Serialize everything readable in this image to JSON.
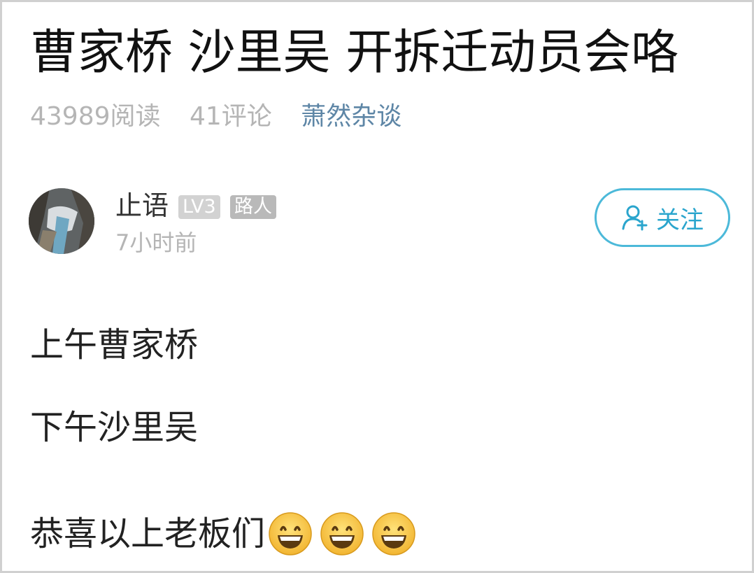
{
  "post": {
    "title": "曹家桥 沙里吴 开拆迁动员会咯",
    "reads": "43989阅读",
    "comments": "41评论",
    "topic": "萧然杂谈"
  },
  "author": {
    "name": "止语",
    "level": "LV3",
    "role": "路人",
    "time": "7小时前"
  },
  "follow_button": {
    "label": "关注",
    "icon": "add-user-icon"
  },
  "content": {
    "line1": "上午曹家桥",
    "line2": "下午沙里吴",
    "line3": "恭喜以上老板们",
    "emoji_icon": "grinning-face-emoji",
    "emoji_count": 3
  },
  "colors": {
    "accent": "#2aa5cd",
    "topic": "#5e86a6",
    "muted": "#b5b5b5"
  }
}
